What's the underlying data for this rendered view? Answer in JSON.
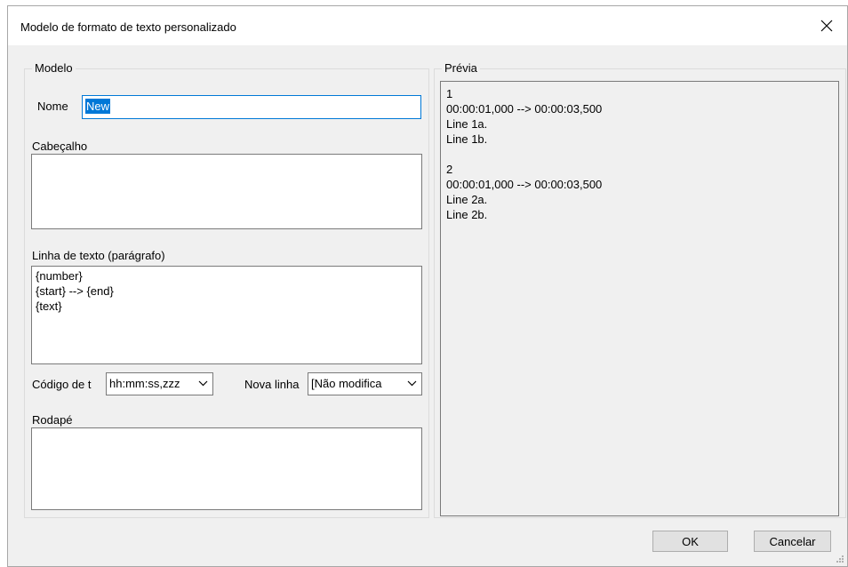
{
  "dialog": {
    "title": "Modelo de formato de texto personalizado",
    "close_icon": "close-icon"
  },
  "modelo": {
    "group_label": "Modelo",
    "name_label": "Nome",
    "name_value": "New",
    "header_label": "Cabeçalho",
    "header_value": "",
    "paragraph_label": "Linha de texto (parágrafo)",
    "paragraph_value": "{number}\n{start} --> {end}\n{text}",
    "timecode_label": "Código de t",
    "timecode_value": "hh:mm:ss,zzz",
    "newline_label": "Nova linha",
    "newline_value": "[Não modifica",
    "footer_label": "Rodapé",
    "footer_value": ""
  },
  "preview": {
    "group_label": "Prévia",
    "text": "1\n00:00:01,000 --> 00:00:03,500\nLine 1a.\nLine 1b.\n\n2\n00:00:01,000 --> 00:00:03,500\nLine 2a.\nLine 2b."
  },
  "buttons": {
    "ok": "OK",
    "cancel": "Cancelar"
  },
  "colors": {
    "accent": "#0078d7",
    "dialog_bg": "#f0f0f0"
  }
}
